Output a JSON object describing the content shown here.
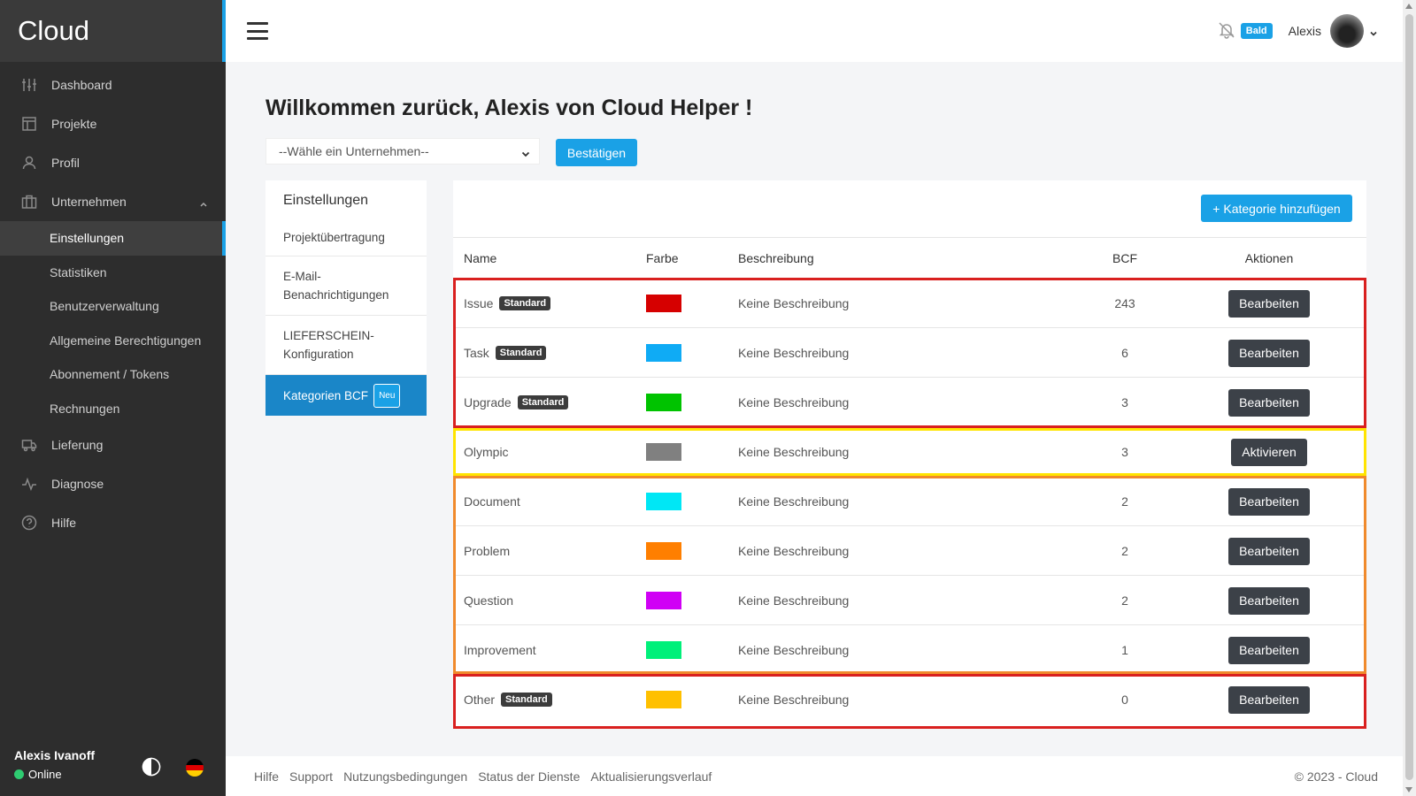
{
  "brand": "Cloud",
  "sidebar": {
    "items": [
      {
        "label": "Dashboard",
        "icon": "sliders-icon"
      },
      {
        "label": "Projekte",
        "icon": "layout-icon"
      },
      {
        "label": "Profil",
        "icon": "user-icon"
      },
      {
        "label": "Unternehmen",
        "icon": "briefcase-icon"
      }
    ],
    "sub_items": [
      "Einstellungen",
      "Statistiken",
      "Benutzerverwaltung",
      "Allgemeine Berechtigungen",
      "Abonnement / Tokens",
      "Rechnungen"
    ],
    "items_after": [
      {
        "label": "Lieferung",
        "icon": "truck-icon"
      },
      {
        "label": "Diagnose",
        "icon": "activity-icon"
      },
      {
        "label": "Hilfe",
        "icon": "help-icon"
      }
    ],
    "user_name": "Alexis Ivanoff",
    "user_status": "Online"
  },
  "topbar": {
    "badge": "Bald",
    "user": "Alexis"
  },
  "main": {
    "title": "Willkommen zurück, Alexis von Cloud Helper !",
    "select_value": "--Wähle ein Unternehmen--",
    "confirm_label": "Bestätigen"
  },
  "settings_menu": {
    "heading": "Einstellungen",
    "items": [
      "Projektübertragung",
      "E-Mail-Benachrichtigungen",
      "LIEFERSCHEIN-Konfiguration",
      "Kategorien BCF"
    ],
    "new_badge": "Neu"
  },
  "table": {
    "add_label": "+ Kategorie hinzufügen",
    "headers": {
      "name": "Name",
      "farbe": "Farbe",
      "beschreibung": "Beschreibung",
      "bcf": "BCF",
      "aktionen": "Aktionen"
    },
    "standard_label": "Standard",
    "rows": [
      {
        "name": "Issue",
        "standard": true,
        "color": "#d60000",
        "desc": "Keine Beschreibung",
        "bcf": "243",
        "action": "Bearbeiten"
      },
      {
        "name": "Task",
        "standard": true,
        "color": "#0fabf5",
        "desc": "Keine Beschreibung",
        "bcf": "6",
        "action": "Bearbeiten"
      },
      {
        "name": "Upgrade",
        "standard": true,
        "color": "#00c300",
        "desc": "Keine Beschreibung",
        "bcf": "3",
        "action": "Bearbeiten"
      },
      {
        "name": "Olympic",
        "standard": false,
        "color": "#808080",
        "desc": "Keine Beschreibung",
        "bcf": "3",
        "action": "Aktivieren"
      },
      {
        "name": "Document",
        "standard": false,
        "color": "#00e7f5",
        "desc": "Keine Beschreibung",
        "bcf": "2",
        "action": "Bearbeiten"
      },
      {
        "name": "Problem",
        "standard": false,
        "color": "#ff7f00",
        "desc": "Keine Beschreibung",
        "bcf": "2",
        "action": "Bearbeiten"
      },
      {
        "name": "Question",
        "standard": false,
        "color": "#d000f5",
        "desc": "Keine Beschreibung",
        "bcf": "2",
        "action": "Bearbeiten"
      },
      {
        "name": "Improvement",
        "standard": false,
        "color": "#00f07a",
        "desc": "Keine Beschreibung",
        "bcf": "1",
        "action": "Bearbeiten"
      },
      {
        "name": "Other",
        "standard": true,
        "color": "#ffc000",
        "desc": "Keine Beschreibung",
        "bcf": "0",
        "action": "Bearbeiten"
      }
    ]
  },
  "highlight_colors": {
    "red": "#d9201f",
    "yellow": "#ffe400",
    "orange": "#f08a2c"
  },
  "footer": {
    "links": [
      "Hilfe",
      "Support",
      "Nutzungsbedingungen",
      "Status der Dienste",
      "Aktualisierungsverlauf"
    ],
    "copyright": "© 2023 - Cloud"
  }
}
